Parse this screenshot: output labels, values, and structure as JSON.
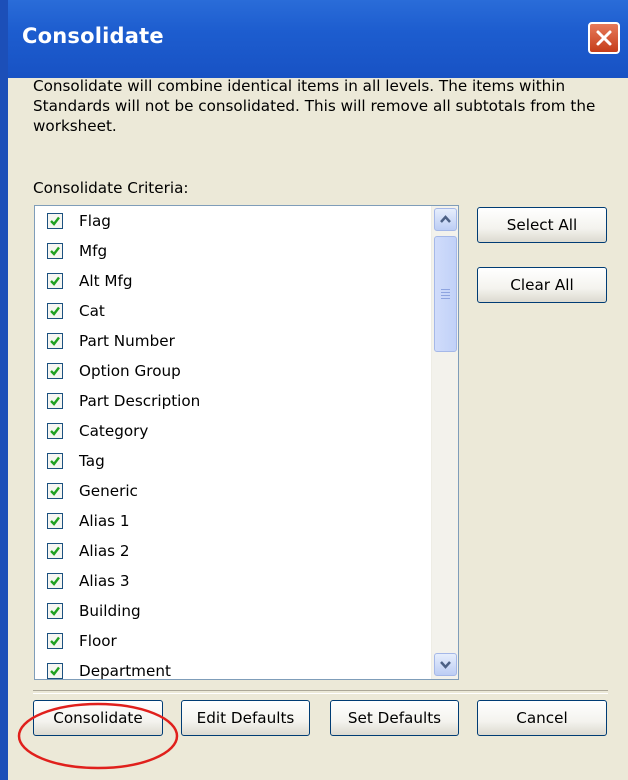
{
  "window": {
    "title": "Consolidate",
    "close_icon": "close-icon"
  },
  "description": "Consolidate will combine identical items in all levels.  The items within Standards will not be consolidated.  This will remove all subtotals from the worksheet.",
  "criteria": {
    "label": "Consolidate Criteria:",
    "items": [
      {
        "label": "Flag",
        "checked": true
      },
      {
        "label": "Mfg",
        "checked": true
      },
      {
        "label": "Alt Mfg",
        "checked": true
      },
      {
        "label": "Cat",
        "checked": true
      },
      {
        "label": "Part Number",
        "checked": true
      },
      {
        "label": "Option Group",
        "checked": true
      },
      {
        "label": "Part Description",
        "checked": true
      },
      {
        "label": "Category",
        "checked": true
      },
      {
        "label": "Tag",
        "checked": true
      },
      {
        "label": "Generic",
        "checked": true
      },
      {
        "label": "Alias 1",
        "checked": true
      },
      {
        "label": "Alias 2",
        "checked": true
      },
      {
        "label": "Alias 3",
        "checked": true
      },
      {
        "label": "Building",
        "checked": true
      },
      {
        "label": "Floor",
        "checked": true
      },
      {
        "label": "Department",
        "checked": true
      }
    ]
  },
  "side_buttons": {
    "select_all": "Select All",
    "clear_all": "Clear All"
  },
  "footer": {
    "consolidate": "Consolidate",
    "edit_defaults": "Edit Defaults",
    "set_defaults": "Set Defaults",
    "cancel": "Cancel"
  },
  "colors": {
    "title_bar": "#1d5dcf",
    "dialog_bg": "#ece9d8",
    "check_mark": "#21a121",
    "highlight": "#e0201c"
  }
}
